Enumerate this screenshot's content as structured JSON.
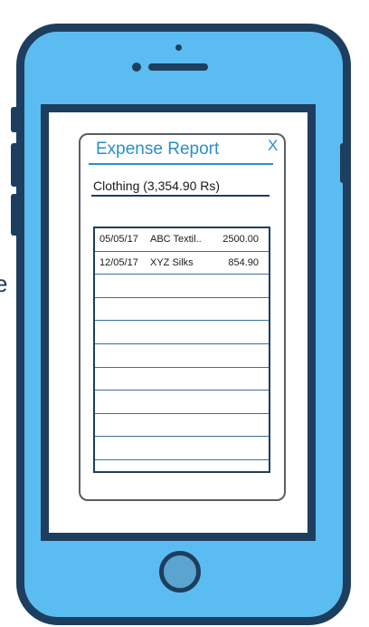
{
  "stray_text": "e",
  "dialog": {
    "title": "Expense Report",
    "close_label": "X",
    "category_summary": "Clothing (3,354.90 Rs)"
  },
  "transactions": [
    {
      "date": "05/05/17",
      "vendor": "ABC Textil..",
      "amount": "2500.00"
    },
    {
      "date": "12/05/17",
      "vendor": "XYZ Silks",
      "amount": "854.90"
    },
    {
      "date": "",
      "vendor": "",
      "amount": ""
    },
    {
      "date": "",
      "vendor": "",
      "amount": ""
    },
    {
      "date": "",
      "vendor": "",
      "amount": ""
    },
    {
      "date": "",
      "vendor": "",
      "amount": ""
    },
    {
      "date": "",
      "vendor": "",
      "amount": ""
    },
    {
      "date": "",
      "vendor": "",
      "amount": ""
    },
    {
      "date": "",
      "vendor": "",
      "amount": ""
    },
    {
      "date": "",
      "vendor": "",
      "amount": ""
    }
  ],
  "colors": {
    "phone_body": "#5bbcf2",
    "phone_frame": "#1d3e5e",
    "accent": "#2a8fc6"
  }
}
